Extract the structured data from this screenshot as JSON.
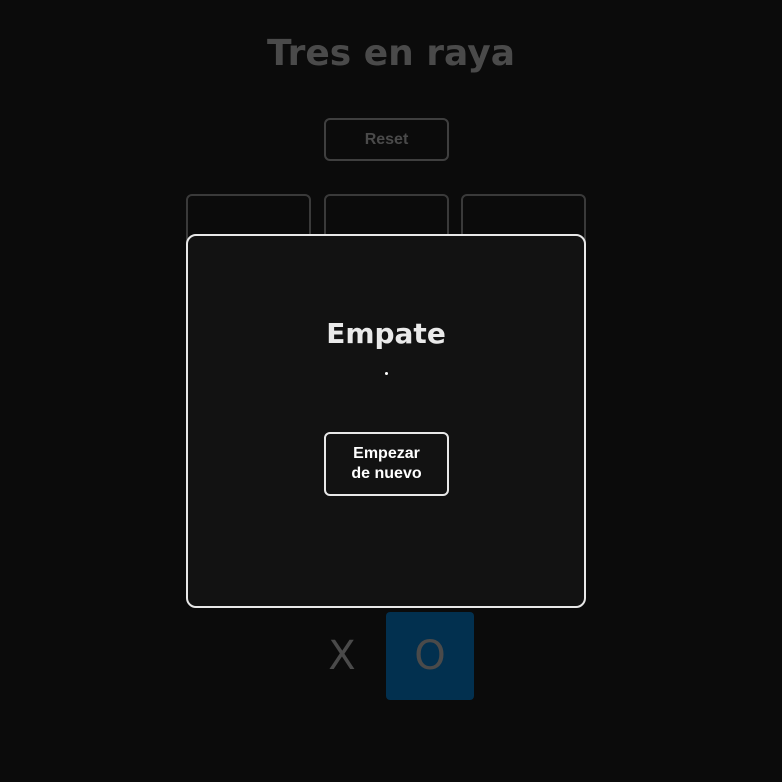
{
  "header": {
    "title": "Tres en raya",
    "reset_label": "Reset"
  },
  "board": {
    "cells": [
      "",
      "",
      "",
      "",
      "",
      "",
      "",
      "",
      ""
    ]
  },
  "turn_indicator": {
    "x_label": "X",
    "o_label": "O",
    "active": "O",
    "active_color": "#02304f"
  },
  "modal": {
    "title": "Empate",
    "winner": "",
    "restart_label": "Empezar de nuevo"
  },
  "colors": {
    "background": "#0b0b0b",
    "modal_background": "#121212",
    "modal_border": "#e8e8e8",
    "dim_text": "#4a4a4a"
  }
}
